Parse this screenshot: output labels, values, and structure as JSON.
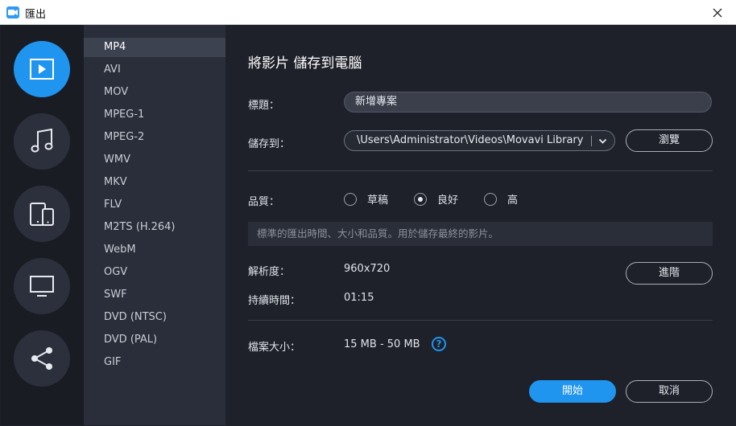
{
  "window": {
    "title": "匯出"
  },
  "rail": {
    "items": [
      {
        "name": "video",
        "icon": "play-icon",
        "active": true
      },
      {
        "name": "audio",
        "icon": "music-note-icon",
        "active": false
      },
      {
        "name": "devices",
        "icon": "devices-icon",
        "active": false
      },
      {
        "name": "tv",
        "icon": "monitor-icon",
        "active": false
      },
      {
        "name": "share",
        "icon": "share-icon",
        "active": false
      }
    ]
  },
  "formats": {
    "items": [
      "MP4",
      "AVI",
      "MOV",
      "MPEG-1",
      "MPEG-2",
      "WMV",
      "MKV",
      "FLV",
      "M2TS (H.264)",
      "WebM",
      "OGV",
      "SWF",
      "DVD (NTSC)",
      "DVD (PAL)",
      "GIF"
    ],
    "selected": "MP4"
  },
  "main": {
    "heading": "將影片 儲存到電腦",
    "title_label": "標題：",
    "title_value": "新增專案",
    "save_label": "儲存到：",
    "save_path": "\\Users\\Administrator\\Videos\\Movavi Library",
    "browse_button": "瀏覽",
    "quality_label": "品質：",
    "quality_options": [
      "草稿",
      "良好",
      "高"
    ],
    "quality_selected": "良好",
    "quality_hint": "標準的匯出時間、大小和品質。用於儲存最終的影片。",
    "resolution_label": "解析度：",
    "resolution_value": "960x720",
    "advanced_button": "進階",
    "duration_label": "持續時間：",
    "duration_value": "01:15",
    "filesize_label": "檔案大小：",
    "filesize_value": "15 MB - 50 MB",
    "help_glyph": "?",
    "start_button": "開始",
    "cancel_button": "取消"
  },
  "colors": {
    "accent": "#1f95ef",
    "panel": "#1e2129",
    "list": "#2a2e3a",
    "rail": "#1a1c23"
  }
}
